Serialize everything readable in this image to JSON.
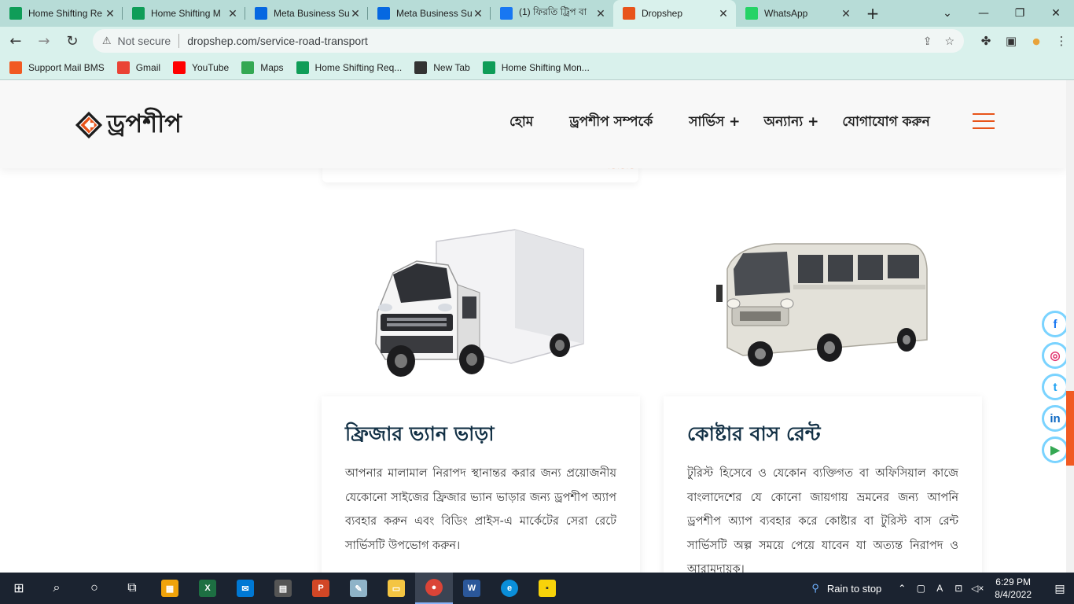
{
  "browser": {
    "tabs": [
      {
        "label": "Home Shifting Re",
        "icon": "sheets-icon",
        "color": "#0f9d58",
        "active": false
      },
      {
        "label": "Home Shifting M",
        "icon": "sheets-icon",
        "color": "#0f9d58",
        "active": false
      },
      {
        "label": "Meta Business Su",
        "icon": "meta-icon",
        "color": "#0668e1",
        "active": false
      },
      {
        "label": "Meta Business Su",
        "icon": "meta-icon",
        "color": "#0668e1",
        "active": false
      },
      {
        "label": "(1) ফিরতি ট্রিপ বা",
        "icon": "facebook-icon",
        "color": "#1877f2",
        "active": false
      },
      {
        "label": "Dropshep",
        "icon": "dropshep-icon",
        "color": "#e8541a",
        "active": true
      },
      {
        "label": "WhatsApp",
        "icon": "whatsapp-icon",
        "color": "#25d366",
        "active": false
      }
    ],
    "address": {
      "security_label": "Not secure",
      "url": "dropshep.com/service-road-transport"
    },
    "bookmarks": [
      {
        "label": "Support Mail BMS",
        "icon": "cp-icon",
        "color": "#f15a22"
      },
      {
        "label": "Gmail",
        "icon": "gmail-icon",
        "color": "#ea4335"
      },
      {
        "label": "YouTube",
        "icon": "youtube-icon",
        "color": "#ff0000"
      },
      {
        "label": "Maps",
        "icon": "maps-icon",
        "color": "#34a853"
      },
      {
        "label": "Home Shifting Req...",
        "icon": "sheets-icon",
        "color": "#0f9d58"
      },
      {
        "label": "New Tab",
        "icon": "globe-icon",
        "color": "#333333"
      },
      {
        "label": "Home Shifting Mon...",
        "icon": "sheets-icon",
        "color": "#0f9d58"
      }
    ]
  },
  "site": {
    "logo_text": "ড্রপশীপ",
    "nav": [
      {
        "label": "হোম"
      },
      {
        "label": "ড্রপশীপ সম্পর্কে"
      },
      {
        "label": "সার্ভিস +"
      },
      {
        "label": "অন্যান্য +"
      },
      {
        "label": "যোগাযোগ করুন"
      }
    ],
    "accent": "#e8541a",
    "services": [
      {
        "title": "ফ্রিজার ভ্যান ভাড়া",
        "description": "আপনার মালামাল নিরাপদ স্থানান্তর করার জন্য প্রয়োজনীয় যেকোনো সাইজের ফ্রিজার ভ্যান ভাড়ার জন্য ড্রপশীপ অ্যাপ ব্যবহার করুন এবং বিডিং প্রাইস-এ মার্কেটের সেরা রেটে সার্ভিসটি উপভোগ করুন।"
      },
      {
        "title": "কোষ্টার বাস রেন্ট",
        "description": "টুরিস্ট হিসেবে ও যেকোন ব্যক্তিগত বা অফিসিয়াল কাজে বাংলাদেশের যে কোনো জায়গায় ভ্রমনের জন্য আপনি ড্রপশীপ অ্যাপ ব্যবহার করে কোষ্টার বা টুরিস্ট বাস রেন্ট সার্ভিসটি অল্প সময়ে পেয়ে যাবেন যা অত্যন্ত নিরাপদ ও আরামদায়ক।"
      }
    ],
    "socials": [
      {
        "icon": "facebook-icon",
        "glyph": "f",
        "color": "#1877f2"
      },
      {
        "icon": "instagram-icon",
        "glyph": "◎",
        "color": "#e1306c"
      },
      {
        "icon": "twitter-icon",
        "glyph": "t",
        "color": "#1da1f2"
      },
      {
        "icon": "linkedin-icon",
        "glyph": "in",
        "color": "#0a66c2"
      },
      {
        "icon": "google-play-icon",
        "glyph": "▶",
        "color": "#34a853"
      }
    ]
  },
  "taskbar": {
    "weather": "Rain to stop",
    "time": "6:29 PM",
    "date": "8/4/2022"
  }
}
